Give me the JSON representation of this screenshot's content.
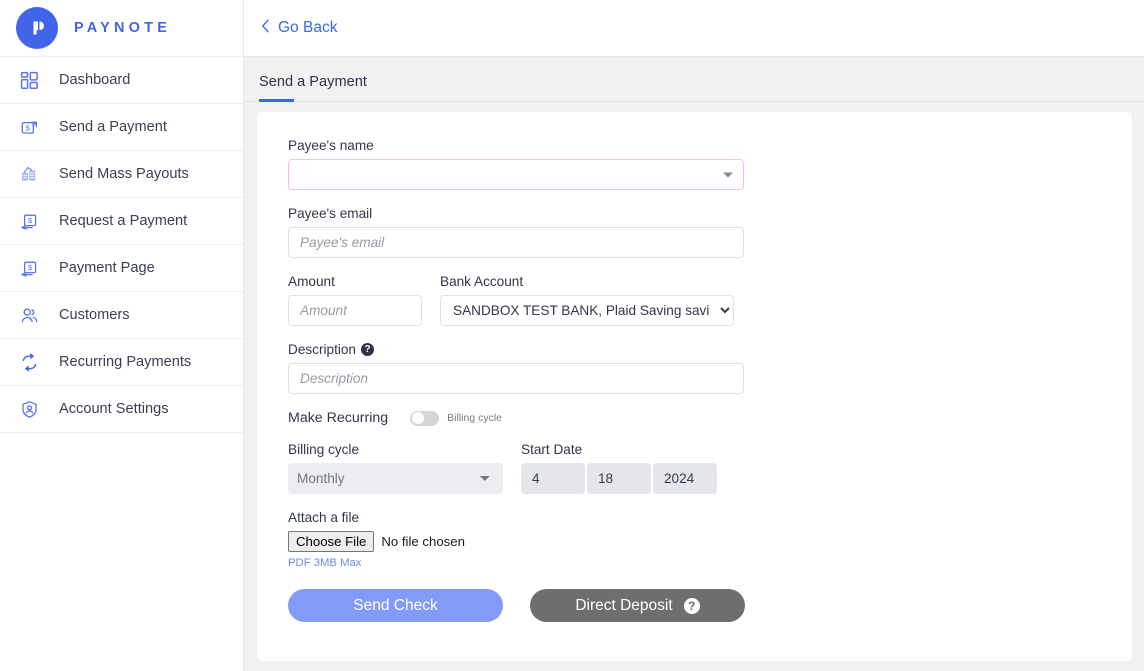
{
  "brand": {
    "name": "PAYNOTE",
    "mark_letter": "P",
    "color": "#4264e8"
  },
  "sidebar": {
    "items": [
      {
        "label": "Dashboard",
        "icon": "dashboard-grid-icon"
      },
      {
        "label": "Send a Payment",
        "icon": "send-payment-icon"
      },
      {
        "label": "Send Mass Payouts",
        "icon": "mass-payouts-icon"
      },
      {
        "label": "Request a Payment",
        "icon": "request-payment-icon"
      },
      {
        "label": "Payment Page",
        "icon": "payment-page-icon"
      },
      {
        "label": "Customers",
        "icon": "customers-icon"
      },
      {
        "label": "Recurring Payments",
        "icon": "recurring-payments-icon"
      },
      {
        "label": "Account Settings",
        "icon": "account-settings-shield-icon"
      }
    ]
  },
  "topbar": {
    "go_back_label": "Go Back",
    "back_icon": "chevron-left-icon"
  },
  "tabs": {
    "active_label": "Send a Payment",
    "indicator_color": "#3767f0"
  },
  "form": {
    "payee_name": {
      "label": "Payee's name",
      "value": "",
      "caret_icon": "caret-down-icon",
      "error_border": "#f4c8c8"
    },
    "payee_email": {
      "label": "Payee's email",
      "placeholder": "Payee's email",
      "value": ""
    },
    "amount": {
      "label": "Amount",
      "placeholder": "Amount",
      "value": ""
    },
    "bank_account": {
      "label": "Bank Account",
      "selected": "SANDBOX TEST BANK, Plaid Saving saving"
    },
    "description": {
      "label": "Description",
      "placeholder": "Description",
      "value": "",
      "help_icon": "help-question-icon",
      "help_glyph": "?"
    },
    "make_recurring": {
      "label": "Make Recurring",
      "toggle_caption": "Billing cycle",
      "enabled": false
    },
    "billing_cycle": {
      "label": "Billing cycle",
      "selected": "Monthly",
      "disabled": true
    },
    "start_date": {
      "label": "Start Date",
      "month": "4",
      "day": "18",
      "year": "2024",
      "disabled": true
    },
    "attach_file": {
      "label": "Attach a file",
      "button_label": "Choose File",
      "status": "No file chosen",
      "hint": "PDF 3MB Max"
    },
    "actions": {
      "send_check_label": "Send Check",
      "direct_deposit_label": "Direct Deposit",
      "direct_deposit_help_glyph": "?",
      "send_check_color": "#829bf8",
      "direct_deposit_color": "#6e6e6e"
    }
  }
}
